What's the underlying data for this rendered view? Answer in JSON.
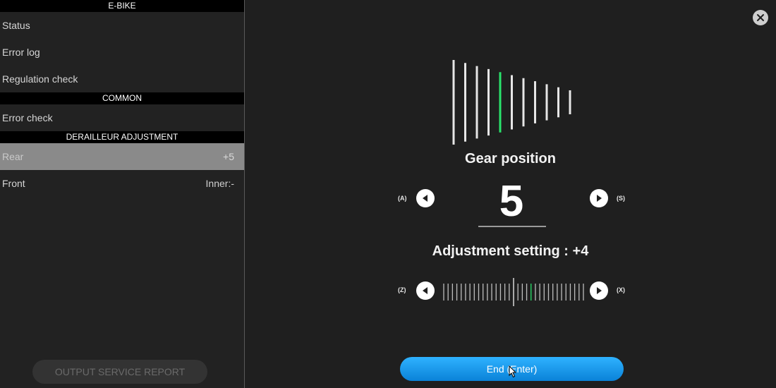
{
  "sidebar": {
    "sections": [
      {
        "header": "E-BIKE",
        "items": [
          {
            "label": "Status",
            "value": ""
          },
          {
            "label": "Error log",
            "value": ""
          },
          {
            "label": "Regulation check",
            "value": ""
          }
        ]
      },
      {
        "header": "COMMON",
        "items": [
          {
            "label": "Error check",
            "value": ""
          }
        ]
      },
      {
        "header": "DERAILLEUR ADJUSTMENT",
        "items": [
          {
            "label": "Rear",
            "value": "+5"
          },
          {
            "label": "Front",
            "value": "Inner:-"
          }
        ]
      }
    ],
    "report_button": "OUTPUT SERVICE REPORT"
  },
  "main": {
    "gear_title": "Gear position",
    "gear_value": "5",
    "gear_total": 11,
    "gear_active": 5,
    "adjust_title": "Adjustment setting : +4",
    "adjust_value": 4,
    "adjust_range": [
      -16,
      16
    ],
    "keys": {
      "gear_prev": "(A)",
      "gear_next": "(S)",
      "adj_prev": "(Z)",
      "adj_next": "(X)"
    },
    "end_button": "End (Enter)"
  },
  "icons": {
    "close": "close-icon",
    "prev": "triangle-left-icon",
    "next": "triangle-right-icon"
  },
  "colors": {
    "accent": "#29e36b",
    "button_blue": "#1a9bf0",
    "selected_row": "#8a8a8a"
  }
}
